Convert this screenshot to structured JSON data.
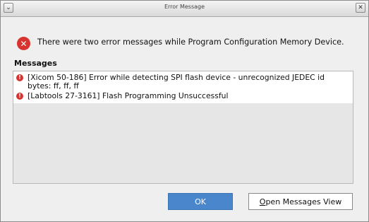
{
  "window": {
    "title": "Error Message",
    "menu_icon": "menu-icon",
    "close_icon": "close-icon"
  },
  "summary": {
    "icon": "error-icon",
    "text": "There were two error messages while Program Configuration Memory Device."
  },
  "messages": {
    "label": "Messages",
    "items": [
      {
        "icon": "error-icon",
        "text": "[Xicom 50-186] Error while detecting SPI flash device - unrecognized JEDEC id bytes: ff, ff, ff"
      },
      {
        "icon": "error-icon",
        "text": "[Labtools 27-3161] Flash Programming Unsuccessful"
      }
    ]
  },
  "buttons": {
    "ok": "OK",
    "open_messages_mnemonic": "O",
    "open_messages_rest": "pen Messages View"
  },
  "colors": {
    "error_red": "#d9332f",
    "primary_button": "#4a86cc"
  }
}
